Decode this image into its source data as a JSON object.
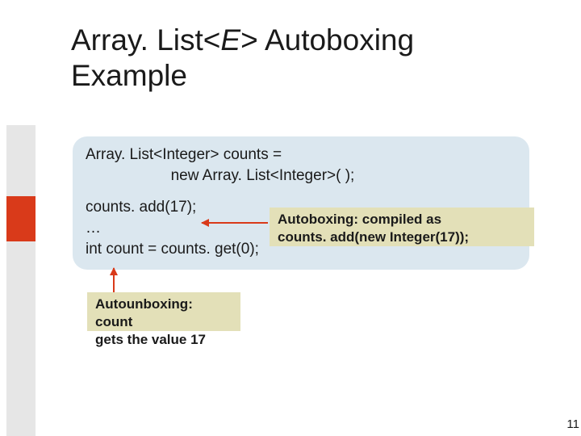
{
  "title": {
    "prefix": "Array. List<",
    "emph": "E",
    "suffix": "> Autoboxing",
    "line2": "Example"
  },
  "code": {
    "line1": "Array. List<Integer> counts =",
    "line2": "                    new Array. List<Integer>( );",
    "line3": "counts. add(17);",
    "line4": "…",
    "line5": "int count = counts. get(0);"
  },
  "callouts": {
    "autobox_l1": "Autoboxing: compiled as",
    "autobox_l2": "counts. add(new Integer(17));",
    "autounbox_l1": "Autounboxing: count",
    "autounbox_l2": "gets the value 17"
  },
  "page_number": "11"
}
